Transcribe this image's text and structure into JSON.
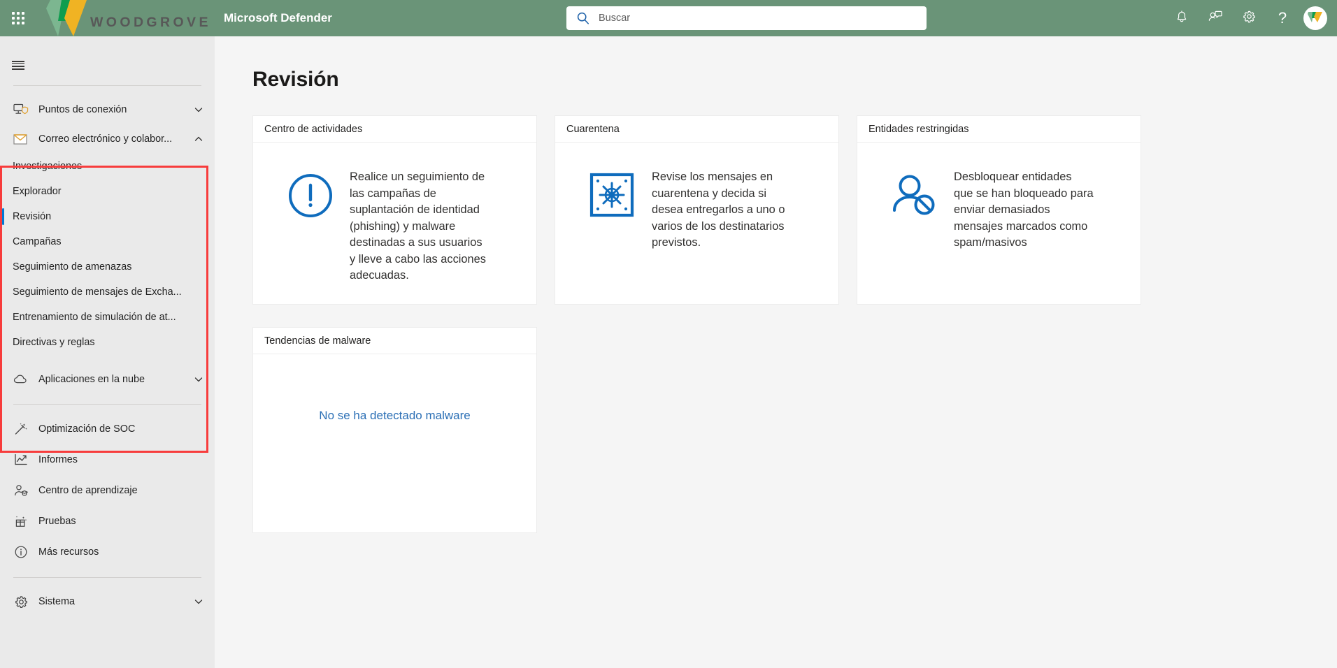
{
  "topbar": {
    "waffle_icon": "app-launcher-waffle-icon",
    "brand_text": "WOODGROVE",
    "app_title": "Microsoft Defender",
    "search": {
      "placeholder": "Buscar",
      "value": "",
      "icon": "search-icon"
    },
    "actions": [
      {
        "name": "notifications",
        "icon": "bell-icon"
      },
      {
        "name": "feedback",
        "icon": "person-feedback-icon"
      },
      {
        "name": "settings",
        "icon": "gear-icon"
      },
      {
        "name": "help",
        "icon": "question-mark-icon",
        "glyph": "?"
      }
    ],
    "avatar": {
      "name": "user-avatar",
      "icon": "woodgrove-w-icon"
    },
    "bar_color": "#6a9478"
  },
  "sidebar": {
    "hamburger_icon": "hamburger-menu-icon",
    "groups": [
      {
        "label": "Puntos de conexión",
        "icon": "device-shield-icon",
        "chevron": "chevron-down-icon",
        "expanded": false,
        "children": []
      },
      {
        "label": "Correo electrónico y colabor...",
        "icon": "envelope-icon",
        "chevron": "chevron-up-icon",
        "expanded": true,
        "children": [
          {
            "label": "Investigaciones",
            "selected": false
          },
          {
            "label": "Explorador",
            "selected": false
          },
          {
            "label": "Revisión",
            "selected": true
          },
          {
            "label": "Campañas",
            "selected": false
          },
          {
            "label": "Seguimiento de amenazas",
            "selected": false
          },
          {
            "label": "Seguimiento de mensajes de Excha...",
            "selected": false
          },
          {
            "label": "Entrenamiento de simulación de at...",
            "selected": false
          },
          {
            "label": "Directivas y reglas",
            "selected": false
          }
        ]
      },
      {
        "label": "Aplicaciones en la nube",
        "icon": "cloud-icon",
        "chevron": "chevron-down-icon",
        "expanded": false,
        "children": []
      }
    ],
    "items": [
      {
        "label": "Optimización de SOC",
        "icon": "magic-wand-icon"
      },
      {
        "label": "Informes",
        "icon": "line-chart-icon"
      },
      {
        "label": "Centro de aprendizaje",
        "icon": "person-graduation-icon"
      },
      {
        "label": "Pruebas",
        "icon": "gift-sparkle-icon"
      },
      {
        "label": "Más recursos",
        "icon": "info-circle-icon"
      }
    ],
    "system": {
      "label": "Sistema",
      "icon": "gear-icon",
      "chevron": "chevron-down-icon"
    },
    "highlight_color": "#f73c3c",
    "selected_indicator_color": "#0078d4",
    "background_color": "#eaeaea"
  },
  "main": {
    "page_title": "Revisión",
    "background_color": "#f5f5f5",
    "accent_color": "#0f6cbd",
    "cards": [
      {
        "title": "Centro de actividades",
        "icon": "exclamation-circle-icon",
        "text": "Realice un seguimiento de las campañas de suplantación de identidad (phishing) y malware destinadas a sus usuarios y lleve a cabo las acciones adecuadas."
      },
      {
        "title": "Cuarentena",
        "icon": "virus-quarantine-box-icon",
        "text": "Revise los mensajes en cuarentena y decida si desea entregarlos a uno o varios de los destinatarios previstos."
      },
      {
        "title": "Entidades restringidas",
        "icon": "person-blocked-icon",
        "text": "Desbloquear entidades que se han bloqueado para enviar demasiados mensajes marcados como spam/masivos"
      }
    ],
    "malware_card": {
      "title": "Tendencias de malware",
      "empty_message": "No se ha detectado malware",
      "empty_message_color": "#2b6fb5"
    }
  }
}
